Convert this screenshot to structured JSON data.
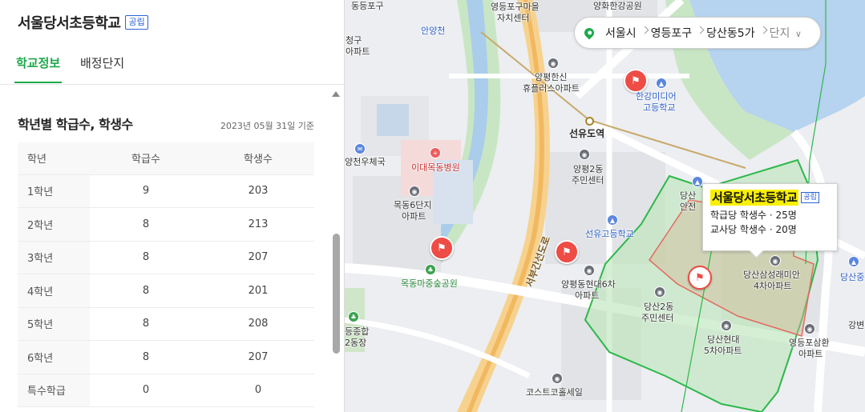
{
  "school": {
    "title": "서울당서초등학교",
    "type_badge": "공립"
  },
  "tabs": [
    {
      "label": "학교정보",
      "active": true
    },
    {
      "label": "배정단지",
      "active": false
    }
  ],
  "section": {
    "title": "학년별 학급수, 학생수",
    "date": "2023년 05월 31일 기준"
  },
  "table": {
    "headers": [
      "학년",
      "학급수",
      "학생수"
    ],
    "rows": [
      [
        "1학년",
        "9",
        "203"
      ],
      [
        "2학년",
        "8",
        "213"
      ],
      [
        "3학년",
        "8",
        "207"
      ],
      [
        "4학년",
        "8",
        "201"
      ],
      [
        "5학년",
        "8",
        "208"
      ],
      [
        "6학년",
        "8",
        "207"
      ],
      [
        "특수학급",
        "0",
        "0"
      ]
    ]
  },
  "breadcrumb": {
    "items": [
      "서울시",
      "영등포구",
      "당산동5가"
    ],
    "dropdown": "단지"
  },
  "popup": {
    "title": "서울당서초등학교",
    "badge": "공립",
    "line1": "학급당 학생수 · 25명",
    "line2": "교사당 학생수 · 20명"
  },
  "map_labels": {
    "l_dongpo": "영등포구마을",
    "l_dongpo2": "자치센터",
    "l_hwahwa": "양화한강공원",
    "l_anyang": "안양천",
    "l_cheonggu": "청구",
    "l_apt": "아파트",
    "l_hanshin1": "양평한신",
    "l_hanshin2": "휴플러스아파트",
    "l_hangang1": "한강미디어",
    "l_hangang2": "고등학교",
    "l_seonyu": "선유도역",
    "l_yangpyeong1": "양평2동",
    "l_yangpyeong2": "주민센터",
    "l_cheonu": "양천우체국",
    "l_ewha": "이대목동병원",
    "l_mokdong1": "목동6단지",
    "l_mokdong2": "아파트",
    "l_seonyu_hs": "선유고등학교",
    "l_seobu": "서부간선도로",
    "l_mokdong_park": "목동마중숲공원",
    "l_hyundai1": "양평동현대6차",
    "l_hyundai2": "아파트",
    "l_dangsan2_1": "당산2동",
    "l_dangsan2_2": "주민센터",
    "l_samsung1": "당산삼성래미안",
    "l_samsung2": "4차아파트",
    "l_dangsan_hd1": "당산현대",
    "l_dangsan_hd2": "5차아파트",
    "l_dongpo_sh1": "영등포삼환",
    "l_dongpo_sh2": "아파트",
    "l_costco": "코스트코홀세일",
    "l_dongjong1": "등종합",
    "l_dongjong2": "2동장",
    "l_dangsan_top1": "당산",
    "l_dangsan_top2": "안전",
    "l_dangsan_right": "당산중",
    "l_gangbyeon": "강변",
    "l_dong_tl": "동등포구"
  }
}
